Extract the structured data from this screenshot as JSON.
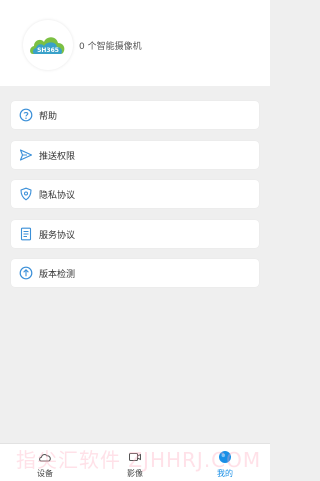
{
  "profile": {
    "logo_text": "SH365",
    "camera_count_text": "0 个智能摄像机"
  },
  "menu": [
    {
      "label": "帮助",
      "icon": "help-circle-icon"
    },
    {
      "label": "推送权限",
      "icon": "send-icon"
    },
    {
      "label": "隐私协议",
      "icon": "shield-icon"
    },
    {
      "label": "服务协议",
      "icon": "document-icon"
    },
    {
      "label": "版本检测",
      "icon": "upgrade-icon"
    }
  ],
  "tabbar": {
    "tabs": [
      {
        "label": "设备",
        "icon": "cloud-device-icon",
        "active": false
      },
      {
        "label": "影像",
        "icon": "video-icon",
        "active": false
      },
      {
        "label": "我的",
        "icon": "profile-icon",
        "active": true
      }
    ]
  },
  "watermark": "指尖汇软件 ZJHHRJ.COM",
  "colors": {
    "accent": "#1a8fe6",
    "icon_blue": "#3a8fd8",
    "background": "#efefef",
    "logo_green": "#7cc043",
    "logo_blue": "#2e9be0"
  }
}
